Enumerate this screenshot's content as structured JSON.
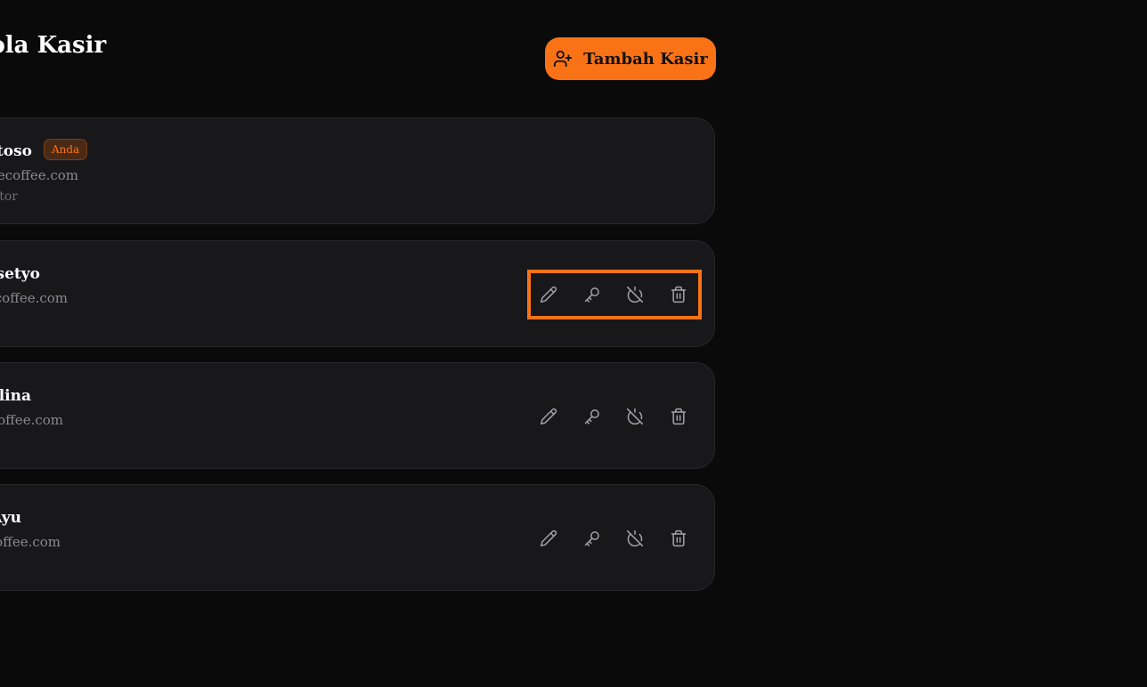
{
  "header": {
    "title": "Kelola Kasir",
    "add_button_label": "Tambah Kasir",
    "add_button_icon": "user-plus-icon"
  },
  "colors": {
    "accent": "#f97316",
    "background": "#0a0a0a",
    "card": "#18181b"
  },
  "users": [
    {
      "name": "Budi Santoso",
      "email": "admin@creativecoffee.com",
      "role": "Administrator",
      "badge": "Anda"
    },
    {
      "name": "Andi Prasetyo",
      "email": "andi@creativecoffee.com"
    },
    {
      "name": "Sari Merlina",
      "email": "sari@creativecoffee.com"
    },
    {
      "name": "Dewi Ayu",
      "email": "dewi@creativecoffee.com"
    }
  ],
  "actions": {
    "icons": [
      "pencil-icon",
      "key-icon",
      "power-off-icon",
      "trash-icon"
    ]
  }
}
